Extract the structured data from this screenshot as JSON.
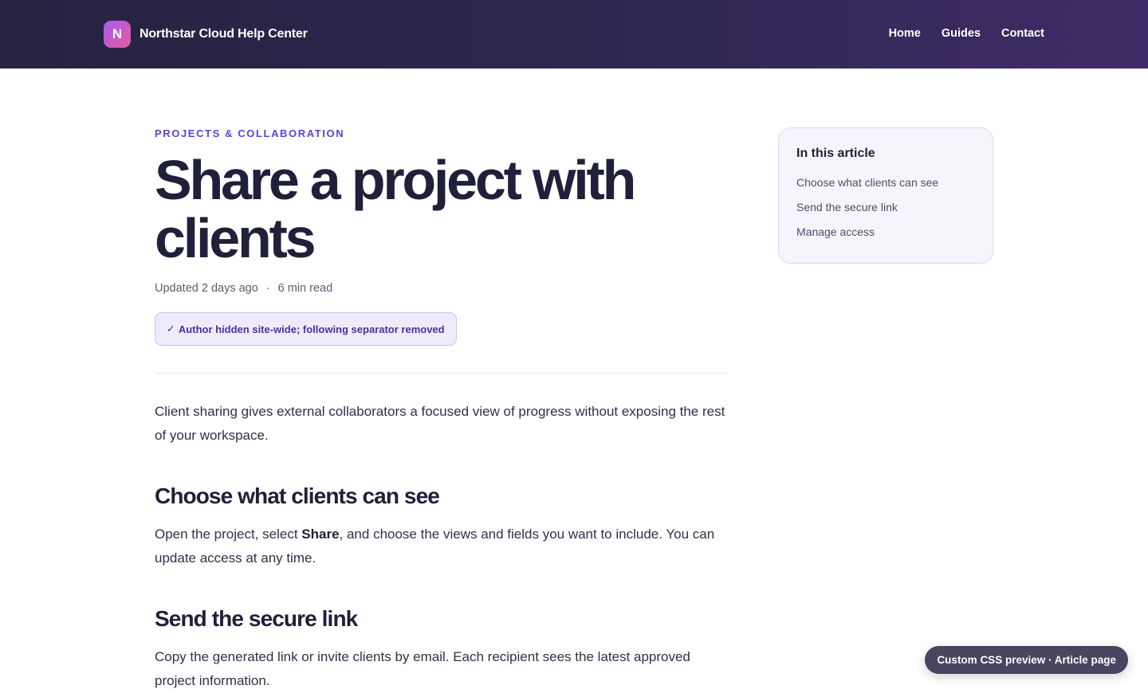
{
  "header": {
    "logo_letter": "N",
    "site_name": "Northstar Cloud Help Center",
    "nav": [
      "Home",
      "Guides",
      "Contact"
    ]
  },
  "article": {
    "category": "PROJECTS & COLLABORATION",
    "title": "Share a project with clients",
    "updated": "Updated 2 days ago",
    "separator": "·",
    "read_time": "6 min read",
    "notice_icon": "✓",
    "notice_text": "Author hidden site-wide; following separator removed",
    "intro": "Client sharing gives external collaborators a focused view of progress without exposing the rest of your workspace.",
    "sections": [
      {
        "heading": "Choose what clients can see",
        "text_before": "Open the project, select ",
        "bold": "Share",
        "text_after": ", and choose the views and fields you want to include. You can update access at any time."
      },
      {
        "heading": "Send the secure link",
        "text": "Copy the generated link or invite clients by email. Each recipient sees the latest approved project information."
      }
    ]
  },
  "toc": {
    "title": "In this article",
    "items": [
      "Choose what clients can see",
      "Send the secure link",
      "Manage access"
    ]
  },
  "preview_badge": "Custom CSS preview · Article page",
  "colors": {
    "header_gradient_start": "#26223f",
    "header_gradient_end": "#3f2c66",
    "accent": "#5a43d8",
    "logo_gradient_start": "#a45cf0",
    "logo_gradient_end": "#e65a9c"
  }
}
